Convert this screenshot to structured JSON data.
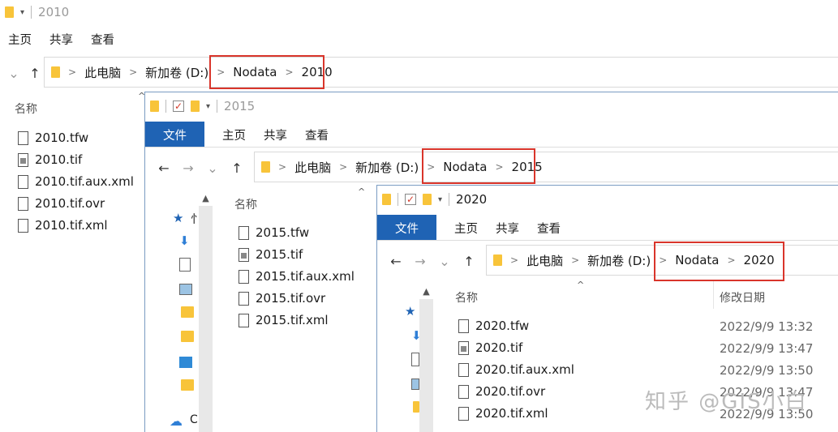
{
  "colors": {
    "accent": "#1f63b4",
    "highlight": "#d9352b",
    "folder": "#f8c43a"
  },
  "common": {
    "sort_caret": "^",
    "arrow": ">"
  },
  "win1": {
    "title": "2010",
    "ribbon": [
      "主页",
      "共享",
      "查看"
    ],
    "path": [
      "此电脑",
      "新加卷 (D:)",
      "Nodata",
      "2010"
    ],
    "col_name": "名称",
    "files": [
      {
        "name": "2010.tfw",
        "icon": "file-icon"
      },
      {
        "name": "2010.tif",
        "icon": "tif-icon"
      },
      {
        "name": "2010.tif.aux.xml",
        "icon": "file-icon"
      },
      {
        "name": "2010.tif.ovr",
        "icon": "file-icon"
      },
      {
        "name": "2010.tif.xml",
        "icon": "file-icon"
      }
    ]
  },
  "win2": {
    "title": "2015",
    "file_tab": "文件",
    "ribbon": [
      "主页",
      "共享",
      "查看"
    ],
    "path": [
      "此电脑",
      "新加卷 (D:)",
      "Nodata",
      "2015"
    ],
    "col_name": "名称",
    "nav_partial_1": "忄",
    "nav_partial_2": "C",
    "files": [
      {
        "name": "2015.tfw",
        "icon": "file-icon"
      },
      {
        "name": "2015.tif",
        "icon": "tif-icon"
      },
      {
        "name": "2015.tif.aux.xml",
        "icon": "file-icon"
      },
      {
        "name": "2015.tif.ovr",
        "icon": "file-icon"
      },
      {
        "name": "2015.tif.xml",
        "icon": "file-icon"
      }
    ]
  },
  "win3": {
    "title": "2020",
    "file_tab": "文件",
    "ribbon": [
      "主页",
      "共享",
      "查看"
    ],
    "path": [
      "此电脑",
      "新加卷 (D:)",
      "Nodata",
      "2020"
    ],
    "col_name": "名称",
    "col_date": "修改日期",
    "files": [
      {
        "name": "2020.tfw",
        "date": "2022/9/9 13:32",
        "icon": "file-icon"
      },
      {
        "name": "2020.tif",
        "date": "2022/9/9 13:47",
        "icon": "tif-icon"
      },
      {
        "name": "2020.tif.aux.xml",
        "date": "2022/9/9 13:50",
        "icon": "file-icon"
      },
      {
        "name": "2020.tif.ovr",
        "date": "2022/9/9 13:47",
        "icon": "file-icon"
      },
      {
        "name": "2020.tif.xml",
        "date": "2022/9/9 13:50",
        "icon": "file-icon"
      }
    ]
  },
  "watermark": "知乎 @GIS小白"
}
